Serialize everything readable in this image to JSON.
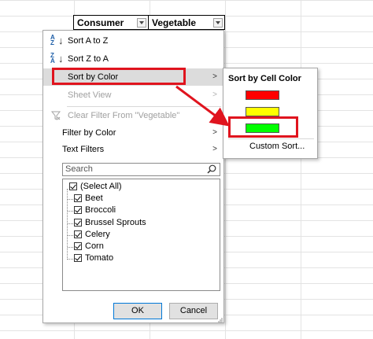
{
  "headers": [
    {
      "label": "Consumer"
    },
    {
      "label": "Vegetable"
    }
  ],
  "menu": {
    "sort_az": "Sort A to Z",
    "sort_za": "Sort Z to A",
    "sort_by_color": "Sort by Color",
    "sheet_view": "Sheet View",
    "clear_filter": "Clear Filter From \"Vegetable\"",
    "filter_by_color": "Filter by Color",
    "text_filters": "Text Filters",
    "submenu_arrow": ">"
  },
  "search": {
    "placeholder": "Search"
  },
  "list_items": [
    {
      "label": "(Select All)",
      "checked": true
    },
    {
      "label": "Beet",
      "checked": true
    },
    {
      "label": "Broccoli",
      "checked": true
    },
    {
      "label": "Brussel Sprouts",
      "checked": true
    },
    {
      "label": "Celery",
      "checked": true
    },
    {
      "label": "Corn",
      "checked": true
    },
    {
      "label": "Tomato",
      "checked": true
    }
  ],
  "buttons": {
    "ok": "OK",
    "cancel": "Cancel"
  },
  "submenu": {
    "title": "Sort by Cell Color",
    "swatches": [
      "#ff0000",
      "#ffff00",
      "#00ff00"
    ],
    "custom_sort": "Custom Sort..."
  },
  "colors": {
    "highlight_outline": "#e0141e",
    "menu_highlight": "#dcdcdc"
  },
  "icons": {
    "sort_az": "sort-ascending-icon",
    "sort_za": "sort-descending-icon",
    "clear_filter": "funnel-clear-icon",
    "search": "magnifier-icon"
  }
}
